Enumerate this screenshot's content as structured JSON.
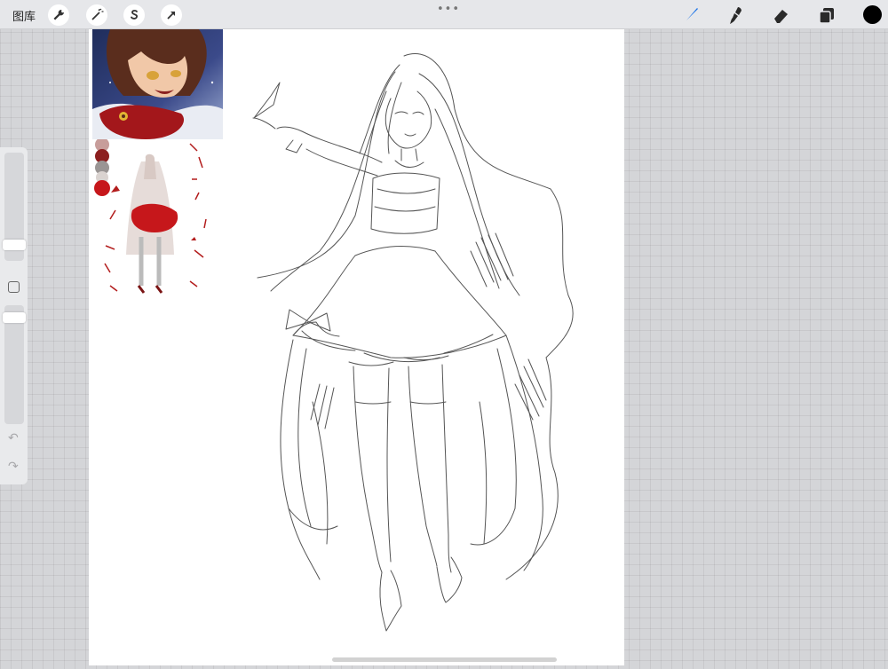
{
  "toolbar": {
    "gallery_label": "图库",
    "left_tools": [
      {
        "name": "actions",
        "icon": "wrench-icon"
      },
      {
        "name": "adjustments",
        "icon": "magic-wand-icon"
      },
      {
        "name": "selection",
        "icon": "selection-s-icon"
      },
      {
        "name": "transform",
        "icon": "arrow-cursor-icon"
      }
    ],
    "grip": "•••",
    "right_tools": [
      {
        "name": "brush",
        "icon": "brush-icon",
        "active": true
      },
      {
        "name": "smudge",
        "icon": "smudge-icon"
      },
      {
        "name": "eraser",
        "icon": "eraser-icon"
      },
      {
        "name": "layers",
        "icon": "layers-icon"
      }
    ],
    "current_color": "#000000",
    "active_color": "#1a73e8"
  },
  "sidebar": {
    "brush_size_level": 0.22,
    "opacity_level": 0.95,
    "undo_icon": "undo-icon",
    "redo_icon": "redo-icon"
  },
  "references": {
    "portrait": "reference-portrait-image",
    "palette_sketch": "reference-colored-sketch-image",
    "palette_colors": [
      "#c79d9a",
      "#8c1f1f",
      "#9a9594",
      "#dad3d0",
      "#c6171b"
    ]
  },
  "canvas": {
    "background": "#ffffff",
    "content": "pencil-sketch-bride-figure"
  }
}
